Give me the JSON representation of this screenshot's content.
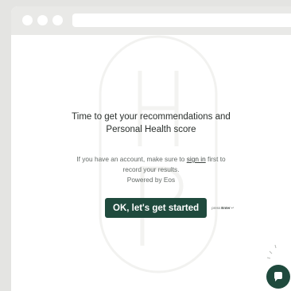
{
  "colors": {
    "background": "#e4e4e2",
    "window": "#ffffff",
    "accent": "#1f4a3d",
    "text": "#2a2f2c",
    "muted": "#646a67"
  },
  "browser": {
    "window_controls": [
      "close",
      "minimize",
      "maximize"
    ]
  },
  "main": {
    "headline_line1": "Time to get your recommendations and",
    "headline_line2": "Personal Health score",
    "info_prefix": "If you have an account, make sure to ",
    "sign_in_link": "sign in",
    "info_suffix": " first to",
    "info_line2": "record your results.",
    "powered_by": "Powered by Eos",
    "cta_label": "OK, let's get started",
    "hint_press": "press",
    "hint_key": "Enter",
    "hint_icon": "↵"
  },
  "icons": {
    "chat": "chat-bubble-icon",
    "watermark": "health-logo-watermark",
    "sparkle": "sparkle-decoration-icon"
  }
}
